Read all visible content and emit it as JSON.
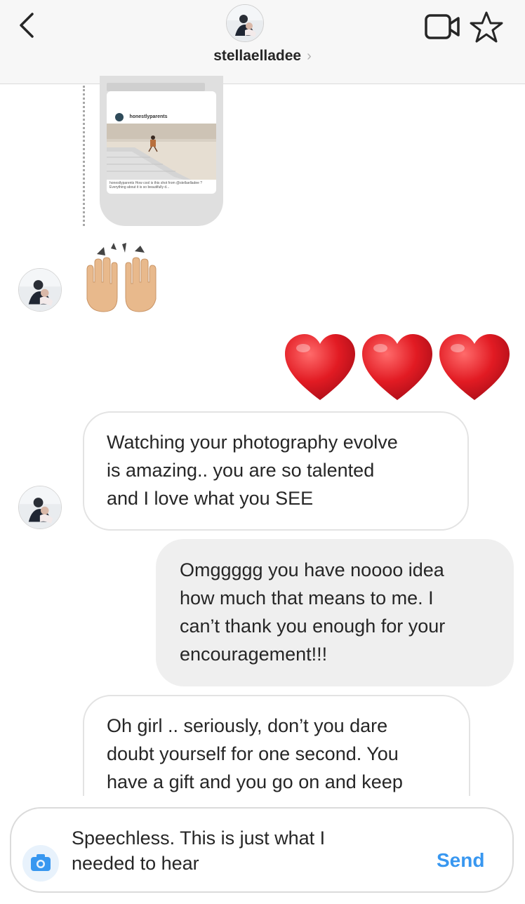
{
  "header": {
    "username": "stellaelladee",
    "chevron": "›",
    "back_icon": "chevron-left-icon",
    "video_icon": "video-camera-icon",
    "star_icon": "star-icon"
  },
  "shared_post": {
    "account": "honestlyparents",
    "caption": "honestlyparents How cool is this shot from @stellaelladee ? Everything about it is so beautifully d..."
  },
  "messages": [
    {
      "id": "m1",
      "direction": "incoming",
      "type": "emoji",
      "content": "🙌"
    },
    {
      "id": "m2",
      "direction": "outgoing",
      "type": "emoji",
      "content": "❤️❤️❤️"
    },
    {
      "id": "m3",
      "direction": "incoming",
      "type": "text",
      "text": "Watching your photography evolve\nis amazing.. you are so talented\nand I love what you SEE"
    },
    {
      "id": "m4",
      "direction": "outgoing",
      "type": "text",
      "text": "Omggggg you have noooo idea\nhow much that means to me. I\ncan’t thank you enough for your\nencouragement!!!"
    },
    {
      "id": "m5",
      "direction": "incoming",
      "type": "text",
      "text": "Oh girl .. seriously, don’t you dare\ndoubt yourself for one second. You\nhave a gift and you go on and keep"
    }
  ],
  "composer": {
    "value": "Speechless. This is just what I\nneeded to hear",
    "send_label": "Send",
    "camera_icon": "camera-icon"
  },
  "colors": {
    "accent": "#3897f0",
    "heart": "#e0202a",
    "header_bg": "#f7f7f7",
    "outgoing_bubble": "#efefef"
  }
}
